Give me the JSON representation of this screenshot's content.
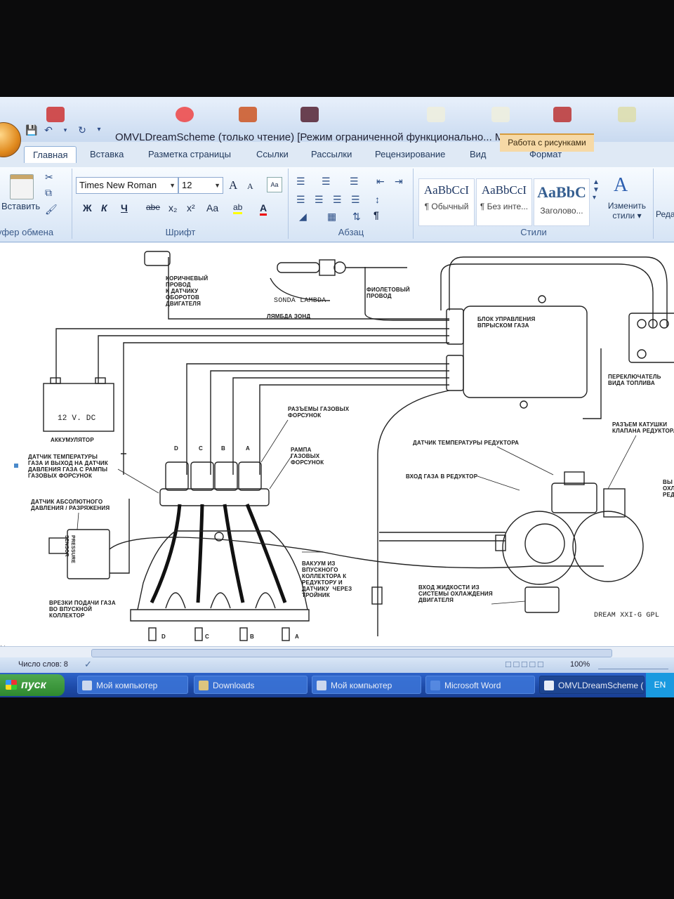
{
  "window": {
    "title": "OMVLDreamScheme (только чтение) [Режим ограниченной функционально... M",
    "context_tab": "Работа с рисунками"
  },
  "tabs": [
    {
      "label": "Главная",
      "active": true
    },
    {
      "label": "Вставка"
    },
    {
      "label": "Разметка страницы"
    },
    {
      "label": "Ссылки"
    },
    {
      "label": "Рассылки"
    },
    {
      "label": "Рецензирование"
    },
    {
      "label": "Вид"
    },
    {
      "label": "Формат"
    }
  ],
  "ribbon": {
    "clipboard": {
      "paste_label": "Вставить",
      "group_label": "уфер обмена"
    },
    "font": {
      "font_name": "Times New Roman",
      "font_size": "12",
      "grow": "A",
      "shrink": "A",
      "bold": "Ж",
      "italic": "К",
      "underline": "Ч",
      "strike": "abe",
      "subscript": "x₂",
      "superscript": "x²",
      "case": "Aa",
      "highlight": "ab",
      "font_color": "A",
      "group_label": "Шрифт"
    },
    "paragraph": {
      "pilcrow": "¶",
      "group_label": "Абзац"
    },
    "styles": {
      "items": [
        {
          "sample": "AaBbCcI",
          "name": "¶ Обычный"
        },
        {
          "sample": "AaBbCcI",
          "name": "¶ Без инте..."
        },
        {
          "sample": "AaBbC",
          "name": "Заголово..."
        }
      ],
      "change_styles": "Изменить стили",
      "change_arrow": "▾",
      "group_label": "Стили",
      "edit_cut": "Реда"
    }
  },
  "diagram": {
    "labels": {
      "brown_wire": "КОРИЧНЕВЫЙ\nПРОВОД\nК ДАТЧИКУ\nОБОРОТОВ\nДВИГАТЕЛЯ",
      "sonda": "SONDA LAMBDA",
      "lambda": "ЛЯМБДА ЗОНД",
      "violet": "ФИОЛЕТОВЫЙ\nПРОВОД",
      "ecu": "БЛОК УПРАВЛЕНИЯ\nВПРЫСКОМ ГАЗА",
      "switch": "ПЕРЕКЛЮЧАТЕЛЬ\nВИДА ТОПЛИВА",
      "battery_volt": "12 V. DC",
      "battery": "АККУМУЛЯТОР",
      "connectors": "РАЗЪЕМЫ ГАЗОВЫХ\nФОРСУНОК",
      "rail": "РАМПА\nГАЗОВЫХ\nФОРСУНОК",
      "temp_gas": "ДАТЧИК ТЕМПЕРАТУРЫ\nГАЗА И ВЫХОД НА ДАТЧИК\nДАВЛЕНИЯ ГАЗА С РАМПЫ\nГАЗОВЫХ ФОРСУНОК",
      "map_sensor": "ДАТЧИК АБСОЛЮТНОГО\nДАВЛЕНИЯ / РАЗРЯЖЕНИЯ",
      "pressure_sensor": "PRESSURE\nSENSOR",
      "reducer_temp": "ДАТЧИК ТЕМПЕРАТУРЫ РЕДУКТОРА",
      "gas_in": "ВХОД ГАЗА В РЕДУКТОР",
      "coil": "РАЗЪЕМ КАТУШКИ\nКЛАПАНА РЕДУКТОРА",
      "right_cut": "ВЫ\nОХЛ\nРЕД",
      "vacuum": "ВАКУУМ ИЗ\nВПУСКНОГО\nКОЛЛЕКТОРА К\nРЕДУКТОРУ И\nДАТЧИКУ  ЧЕРЕЗ\nТРОЙНИК",
      "coolant": "ВХОД ЖИДКОСТИ ИЗ\nСИСТЕМЫ ОХЛАЖДЕНИЯ\nДВИГАТЕЛЯ",
      "nipples": "ВРЕЗКИ ПОДАЧИ ГАЗА\nВО ВПУСКНОЙ\nКОЛЛЕКТОР",
      "dream": "DREAM XXI-G GPL",
      "letters": [
        "D",
        "C",
        "B",
        "A"
      ]
    }
  },
  "status": {
    "word_count": "Число слов: 8",
    "zoom": "100%",
    "side_cut": "No"
  },
  "taskbar": {
    "start": "пуск",
    "items": [
      {
        "label": "Мой компьютер"
      },
      {
        "label": "Downloads"
      },
      {
        "label": "Мой компьютер"
      },
      {
        "label": "Microsoft Word"
      },
      {
        "label": "OMVLDreamScheme (..."
      }
    ],
    "lang": "EN"
  }
}
